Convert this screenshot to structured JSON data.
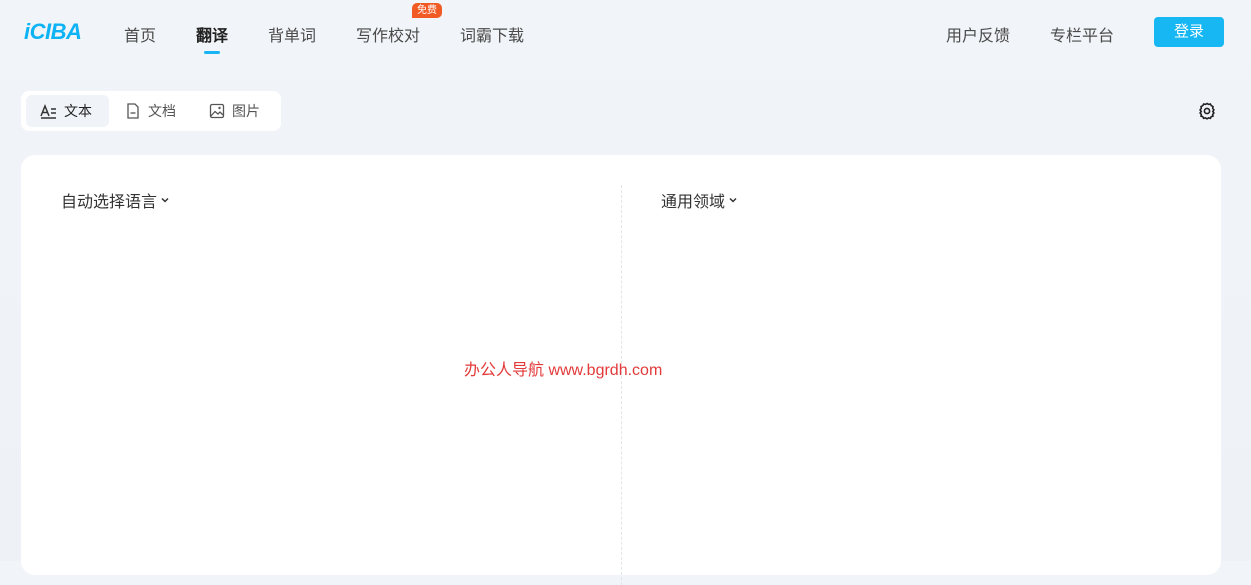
{
  "header": {
    "logo": "iCIBA",
    "nav": [
      {
        "label": "首页"
      },
      {
        "label": "翻译",
        "active": true
      },
      {
        "label": "背单词"
      },
      {
        "label": "写作校对",
        "badge": "免费"
      },
      {
        "label": "词霸下载"
      }
    ],
    "right_links": [
      {
        "label": "用户反馈"
      },
      {
        "label": "专栏平台"
      }
    ],
    "login_label": "登录"
  },
  "modes": [
    {
      "label": "文本",
      "icon": "text-icon",
      "active": true
    },
    {
      "label": "文档",
      "icon": "document-icon"
    },
    {
      "label": "图片",
      "icon": "image-icon"
    }
  ],
  "settings_icon": "gear-icon",
  "translator": {
    "source_language": "自动选择语言",
    "domain": "通用领域"
  },
  "watermark": "办公人导航  www.bgrdh.com",
  "colors": {
    "accent": "#17b7f4",
    "badge": "#f25a24",
    "watermark": "#e23a3a"
  }
}
